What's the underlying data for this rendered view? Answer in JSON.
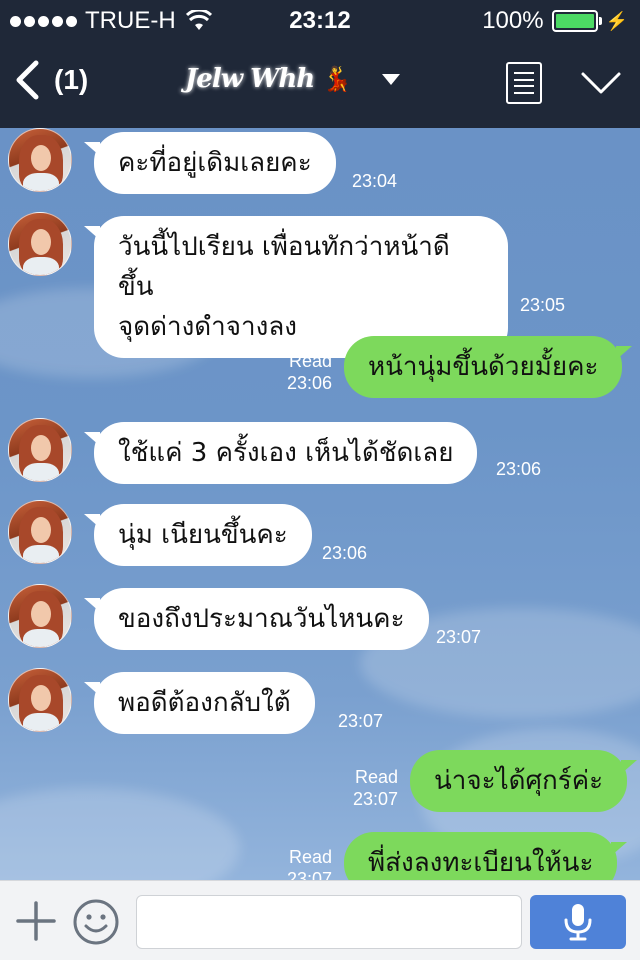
{
  "status_bar": {
    "carrier": "TRUE-H",
    "time": "23:12",
    "battery": "100%",
    "battery_level": 1.0
  },
  "nav": {
    "back_count": "(1)",
    "contact_name": "Jelw Whh",
    "title_emoji": "💃"
  },
  "colors": {
    "nav_bg": "#1f2838",
    "incoming_bubble": "#ffffff",
    "outgoing_bubble": "#7dd95c",
    "chat_bg": "#6c95c8",
    "send_button": "#4f82d8"
  },
  "messages": [
    {
      "direction": "in",
      "text": "คะที่อยู่เดิมเลยคะ",
      "time": "23:04"
    },
    {
      "direction": "in",
      "lines": [
        "วันนี้ไปเรียน เพื่อนทักว่าหน้าดีขึ้น",
        "จุดด่างดำจางลง"
      ],
      "time": "23:05"
    },
    {
      "direction": "out",
      "text": "หน้านุ่มขึ้นด้วยมั้ยคะ",
      "read": "Read",
      "time": "23:06"
    },
    {
      "direction": "in",
      "text": "ใช้แค่ 3 ครั้งเอง เห็นได้ชัดเลย",
      "time": "23:06"
    },
    {
      "direction": "in",
      "text": "นุ่ม เนียนขึ้นคะ",
      "time": "23:06"
    },
    {
      "direction": "in",
      "text": "ของถึงประมาณวันไหนคะ",
      "time": "23:07"
    },
    {
      "direction": "in",
      "text": "พอดีต้องกลับใต้",
      "time": "23:07"
    },
    {
      "direction": "out",
      "text": "น่าจะได้ศุกร์ค่ะ",
      "read": "Read",
      "time": "23:07"
    },
    {
      "direction": "out",
      "text": "พี่ส่งลงทะเบียนให้นะ",
      "read": "Read",
      "time": "23:07"
    }
  ],
  "input": {
    "placeholder": "",
    "value": ""
  },
  "icons": {
    "back": "chevron-left-icon",
    "dropdown": "caret-down-icon",
    "menu": "menu-icon",
    "collapse": "chevron-down-icon",
    "add": "plus-icon",
    "emoji": "smiley-icon",
    "voice": "microphone-icon"
  }
}
